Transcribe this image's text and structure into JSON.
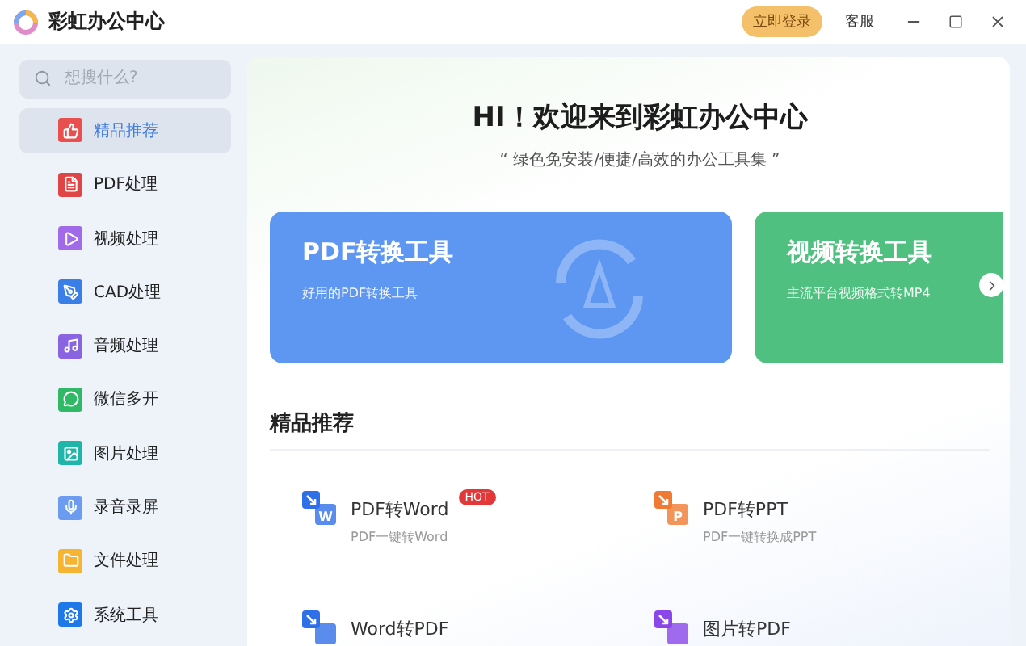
{
  "window": {
    "title": "彩虹办公中心",
    "login_button": "立即登录",
    "service_link": "客服"
  },
  "search": {
    "placeholder": "想搜什么?"
  },
  "sidebar": {
    "items": [
      {
        "label": "精品推荐",
        "selected": true,
        "color": "#e8504f"
      },
      {
        "label": "PDF处理",
        "selected": false,
        "color": "#e04545"
      },
      {
        "label": "视频处理",
        "selected": false,
        "color": "#a16ae8"
      },
      {
        "label": "CAD处理",
        "selected": false,
        "color": "#3a7ee8"
      },
      {
        "label": "音频处理",
        "selected": false,
        "color": "#8a63e0"
      },
      {
        "label": "微信多开",
        "selected": false,
        "color": "#2fb866"
      },
      {
        "label": "图片处理",
        "selected": false,
        "color": "#1fb5a8"
      },
      {
        "label": "录音录屏",
        "selected": false,
        "color": "#6b9cf0"
      },
      {
        "label": "文件处理",
        "selected": false,
        "color": "#f5b431"
      },
      {
        "label": "系统工具",
        "selected": false,
        "color": "#1f78e8"
      }
    ]
  },
  "hero": {
    "title": "HI！欢迎来到彩虹办公中心",
    "subtitle": "“ 绿色免安装/便捷/高效的办公工具集 ”"
  },
  "banners": [
    {
      "title": "PDF转换工具",
      "subtitle": "好用的PDF转换工具",
      "color": "#5d97f2"
    },
    {
      "title": "视频转换工具",
      "subtitle": "主流平台视频格式转MP4",
      "color": "#4fc07f"
    }
  ],
  "section": {
    "title": "精品推荐"
  },
  "tools": [
    {
      "name": "PDF转Word",
      "desc": "PDF一键转Word",
      "badge": "HOT",
      "color": "#2f6fe8",
      "letter": "W"
    },
    {
      "name": "PDF转PPT",
      "desc": "PDF一键转换成PPT",
      "color": "#f07a32",
      "letter": "P"
    },
    {
      "name": "Word转PDF",
      "color": "#2f6fe8"
    },
    {
      "name": "图片转PDF",
      "color": "#8a46e8"
    }
  ]
}
